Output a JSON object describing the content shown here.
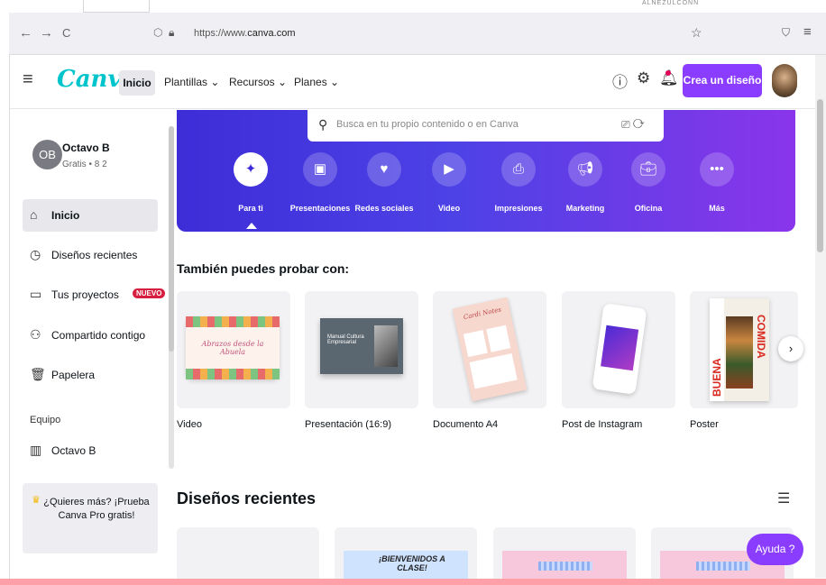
{
  "browser": {
    "top_text": "ALNEZULCONN",
    "back": "←",
    "forward": "→",
    "reload": "C",
    "url_prefix": "https://www.",
    "url_domain": "canva.com",
    "bookmark": "☆",
    "pocket": "⛉",
    "menu": "≡"
  },
  "header": {
    "logo": "Canva",
    "tabs": [
      "Inicio",
      "Plantillas ⌄",
      "Recursos ⌄",
      "Planes ⌄"
    ],
    "create_button": "Crea un diseño"
  },
  "sidebar": {
    "user_initials": "OB",
    "user_name": "Octavo B",
    "user_plan": "Gratis • 8 2",
    "items": [
      "Inicio",
      "Diseños recientes",
      "Tus proyectos",
      "Compartido contigo",
      "Papelera"
    ],
    "new_badge": "NUEVO",
    "team_label": "Equipo",
    "team_item": "Octavo B",
    "pro_text": "¿Quieres más? ¡Prueba Canva Pro gratis!"
  },
  "hero": {
    "search_placeholder": "Busca en tu propio contenido o en Canva",
    "categories": [
      "Para ti",
      "Presentaciones",
      "Redes sociales",
      "Video",
      "Impresiones",
      "Marketing",
      "Oficina",
      "Más"
    ]
  },
  "templates": {
    "title": "También puedes probar con:",
    "items": [
      "Video",
      "Presentación (16:9)",
      "Documento A4",
      "Post de Instagram",
      "Poster"
    ],
    "thumb_texts": {
      "video": "Abrazos desde la Abuela",
      "presentation": "Manual Cultura Empresarial",
      "document": "Cardi Notes",
      "poster_a": "BUENA",
      "poster_b": "COMIDA"
    }
  },
  "recent": {
    "title": "Diseños recientes",
    "card_text": "¡BIENVENIDOS A CLASE!"
  },
  "help_button": "Ayuda ?"
}
